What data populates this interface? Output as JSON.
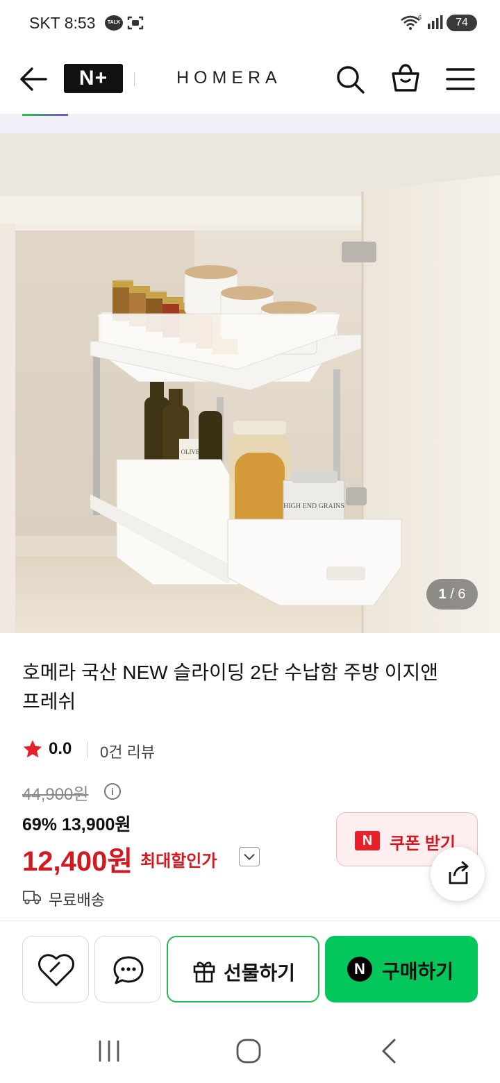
{
  "status_bar": {
    "carrier_time": "SKT 8:53",
    "talk_badge": "TALK",
    "battery": "74"
  },
  "header": {
    "logo": "N+",
    "brand": "HOMERA"
  },
  "gallery": {
    "counter_current": "1",
    "counter_total": "/ 6",
    "image_labels": {
      "bottle_label": "OLIVE",
      "tin_label": "HIGH END GRAINS"
    }
  },
  "product": {
    "title": "호메라 국산 NEW 슬라이딩 2단 수납함 주방 이지앤프레쉬",
    "rating": "0.0",
    "review_count": "0건 리뷰",
    "original_price": "44,900원",
    "discount": "69% 13,900원",
    "final_price": "12,400원",
    "final_label": "최대할인가",
    "shipping": "무료배송"
  },
  "coupon": {
    "badge": "N",
    "label": "쿠폰 받기"
  },
  "actions": {
    "gift_label": "선물하기",
    "buy_badge": "N",
    "buy_label": "구매하기"
  },
  "colors": {
    "price_red": "#d2191f",
    "naver_green": "#03c75a",
    "coupon_bg": "#fdeef0"
  },
  "icons": [
    "back-arrow-icon",
    "search-icon",
    "shopping-bag-icon",
    "menu-icon",
    "star-icon",
    "info-icon",
    "chevron-down-icon",
    "truck-icon",
    "share-icon",
    "heart-icon",
    "chat-icon",
    "gift-icon"
  ]
}
